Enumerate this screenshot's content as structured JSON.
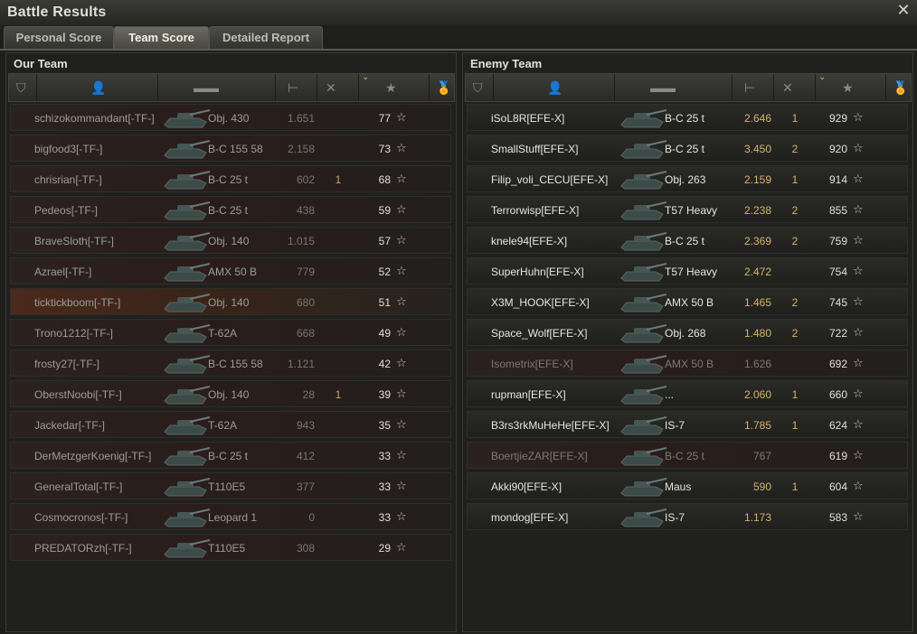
{
  "window": {
    "title": "Battle Results",
    "close_icon": "close-icon"
  },
  "tabs": [
    {
      "label": "Personal Score",
      "active": false
    },
    {
      "label": "Team Score",
      "active": true
    },
    {
      "label": "Detailed Report",
      "active": false
    }
  ],
  "our_team": {
    "title": "Our Team",
    "rows": [
      {
        "player": "schizokommandant[-TF-]",
        "tank": "Obj. 430",
        "damage": "1.651",
        "kills": "",
        "xp": "77",
        "state": "dead"
      },
      {
        "player": "bigfood3[-TF-]",
        "tank": "B-C 155 58",
        "damage": "2.158",
        "kills": "",
        "xp": "73",
        "state": "dead"
      },
      {
        "player": "chrisrian[-TF-]",
        "tank": "B-C 25 t",
        "damage": "602",
        "kills": "1",
        "xp": "68",
        "state": "dead"
      },
      {
        "player": "Pedeos[-TF-]",
        "tank": "B-C 25 t",
        "damage": "438",
        "kills": "",
        "xp": "59",
        "state": "dead"
      },
      {
        "player": "BraveSloth[-TF-]",
        "tank": "Obj. 140",
        "damage": "1.015",
        "kills": "",
        "xp": "57",
        "state": "dead"
      },
      {
        "player": "Azrael[-TF-]",
        "tank": "AMX 50 B",
        "damage": "779",
        "kills": "",
        "xp": "52",
        "state": "dead"
      },
      {
        "player": "ticktickboom[-TF-]",
        "tank": "Obj. 140",
        "damage": "680",
        "kills": "",
        "xp": "51",
        "state": "mine"
      },
      {
        "player": "Trono1212[-TF-]",
        "tank": "T-62A",
        "damage": "668",
        "kills": "",
        "xp": "49",
        "state": "dead"
      },
      {
        "player": "frosty27[-TF-]",
        "tank": "B-C 155 58",
        "damage": "1.121",
        "kills": "",
        "xp": "42",
        "state": "dead"
      },
      {
        "player": "OberstNoobi[-TF-]",
        "tank": "Obj. 140",
        "damage": "28",
        "kills": "1",
        "xp": "39",
        "state": "dead"
      },
      {
        "player": "Jackedar[-TF-]",
        "tank": "T-62A",
        "damage": "943",
        "kills": "",
        "xp": "35",
        "state": "dead"
      },
      {
        "player": "DerMetzgerKoenig[-TF-]",
        "tank": "B-C 25 t",
        "damage": "412",
        "kills": "",
        "xp": "33",
        "state": "dead"
      },
      {
        "player": "GeneralTotal[-TF-]",
        "tank": "T110E5",
        "damage": "377",
        "kills": "",
        "xp": "33",
        "state": "dead"
      },
      {
        "player": "Cosmocronos[-TF-]",
        "tank": "Leopard 1",
        "damage": "0",
        "kills": "",
        "xp": "33",
        "state": "dead"
      },
      {
        "player": "PREDATORzh[-TF-]",
        "tank": "T110E5",
        "damage": "308",
        "kills": "",
        "xp": "29",
        "state": "dead"
      }
    ]
  },
  "enemy_team": {
    "title": "Enemy Team",
    "rows": [
      {
        "player": "iSoL8R[EFE-X]",
        "tank": "B-C 25 t",
        "damage": "2.646",
        "kills": "1",
        "xp": "929",
        "state": "alive"
      },
      {
        "player": "SmallStuff[EFE-X]",
        "tank": "B-C 25 t",
        "damage": "3.450",
        "kills": "2",
        "xp": "920",
        "state": "alive"
      },
      {
        "player": "Filip_voli_CECU[EFE-X]",
        "tank": "Obj. 263",
        "damage": "2.159",
        "kills": "1",
        "xp": "914",
        "state": "alive"
      },
      {
        "player": "Terrorwisp[EFE-X]",
        "tank": "T57 Heavy",
        "damage": "2.238",
        "kills": "2",
        "xp": "855",
        "state": "alive"
      },
      {
        "player": "knele94[EFE-X]",
        "tank": "B-C 25 t",
        "damage": "2.369",
        "kills": "2",
        "xp": "759",
        "state": "alive"
      },
      {
        "player": "SuperHuhn[EFE-X]",
        "tank": "T57 Heavy",
        "damage": "2.472",
        "kills": "",
        "xp": "754",
        "state": "alive"
      },
      {
        "player": "X3M_HOOK[EFE-X]",
        "tank": "AMX 50 B",
        "damage": "1.465",
        "kills": "2",
        "xp": "745",
        "state": "alive"
      },
      {
        "player": "Space_Wolf[EFE-X]",
        "tank": "Obj. 268",
        "damage": "1.480",
        "kills": "2",
        "xp": "722",
        "state": "alive"
      },
      {
        "player": "Isometrix[EFE-X]",
        "tank": "AMX 50 B",
        "damage": "1.626",
        "kills": "",
        "xp": "692",
        "state": "dead"
      },
      {
        "player": "rupman[EFE-X]",
        "tank": "...",
        "damage": "2.060",
        "kills": "1",
        "xp": "660",
        "state": "alive"
      },
      {
        "player": "B3rs3rkMuHeHe[EFE-X]",
        "tank": "IS-7",
        "damage": "1.785",
        "kills": "1",
        "xp": "624",
        "state": "alive"
      },
      {
        "player": "BoertjieZAR[EFE-X]",
        "tank": "B-C 25 t",
        "damage": "767",
        "kills": "",
        "xp": "619",
        "state": "dead"
      },
      {
        "player": "Akki90[EFE-X]",
        "tank": "Maus",
        "damage": "590",
        "kills": "1",
        "xp": "604",
        "state": "alive"
      },
      {
        "player": "mondog[EFE-X]",
        "tank": "IS-7",
        "damage": "1.173",
        "kills": "",
        "xp": "583",
        "state": "alive"
      }
    ]
  },
  "header_icons": [
    "rank-icon",
    "player-icon",
    "tank-icon",
    "damage-icon",
    "kills-icon",
    "xp-star-icon",
    "medal-icon"
  ],
  "colors": {
    "accent": "#d7b36a",
    "my_row": "#4a2a1c",
    "dead_row": "#2a1d1b"
  }
}
